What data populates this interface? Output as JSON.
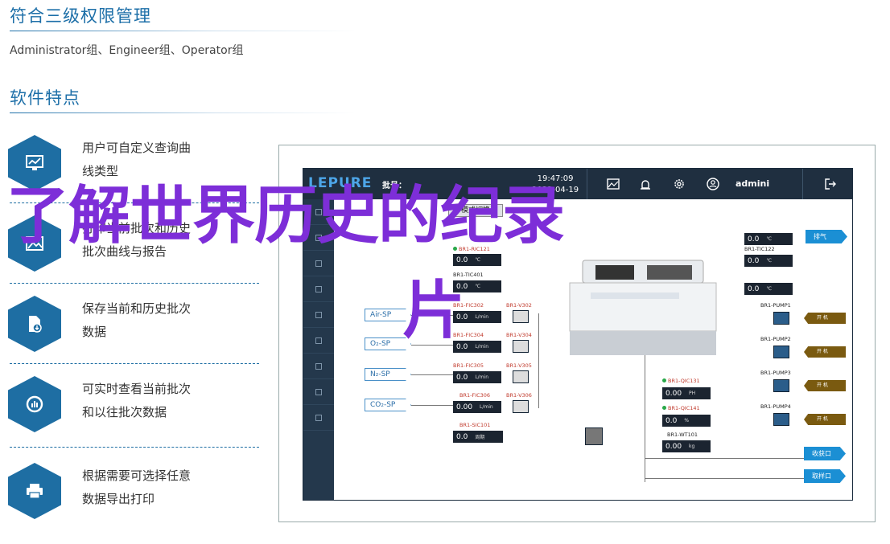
{
  "header": {
    "title": "符合三级权限管理",
    "subtitle": "Administrator组、Engineer组、Operator组",
    "section_title": "软件特点"
  },
  "features": [
    {
      "icon": "chart-monitor-icon",
      "line1": "用户可自定义查询曲",
      "line2": "线类型"
    },
    {
      "icon": "image-print-icon",
      "line1": "打印当前批次和历史",
      "line2": "批次曲线与报告"
    },
    {
      "icon": "file-download-icon",
      "line1": "保存当前和历史批次",
      "line2": "数据"
    },
    {
      "icon": "gauge-icon",
      "line1": "可实时查看当前批次",
      "line2": "和以往批次数据"
    },
    {
      "icon": "printer-icon",
      "line1": "根据需要可选择任意",
      "line2": "数据导出打印"
    }
  ],
  "screen": {
    "logo": "LEPURE",
    "batch_label": "批号：",
    "time": "19:47:09",
    "date": "2022-04-19",
    "user": "admini",
    "mode_button": "模式切换",
    "tags": {
      "ric121": "BR1-RIC121",
      "tic301": "BR1-TIC301",
      "tic401": "BR1-TIC401",
      "fic302": "BR1-FIC302",
      "v302": "BR1-V302",
      "fic304": "BR1-FIC304",
      "v304": "BR1-V304",
      "fic305": "BR1-FIC305",
      "v305": "BR1-V305",
      "fic306": "BR1-FIC306",
      "v306": "BR1-V306",
      "sic101": "BR1-SIC101",
      "tic121": "BR1-TIC121",
      "tic122": "BR1-TIC122",
      "tic402": "BR1-TIC402",
      "qic131": "BR1-QIC131",
      "qic141": "BR1-QIC141",
      "wt101": "BR1-WT101",
      "pump1": "BR1-PUMP1",
      "pump2": "BR1-PUMP2",
      "pump3": "BR1-PUMP3",
      "pump4": "BR1-PUMP4"
    },
    "values": {
      "zero": "0.0",
      "zero2": "0.00",
      "u_mbar": "mbar",
      "u_c": "℃",
      "u_lmin": "L/min",
      "u_rpm": "周期",
      "u_ph": "PH",
      "u_pct": "%",
      "u_kg": "kg"
    },
    "sp": [
      "Air-SP",
      "O₂-SP",
      "N₂-SP",
      "CO₂-SP"
    ],
    "warn": "开 机",
    "sample_in": "收获口",
    "sample_out": "取样口",
    "right_top_btn": "排气"
  },
  "overlay": {
    "line1": "了解世界历史的纪录",
    "line2": "片"
  },
  "colors": {
    "accent": "#1d6fa8",
    "overlay": "#7d2ed8",
    "topbar": "#1f2f40"
  }
}
